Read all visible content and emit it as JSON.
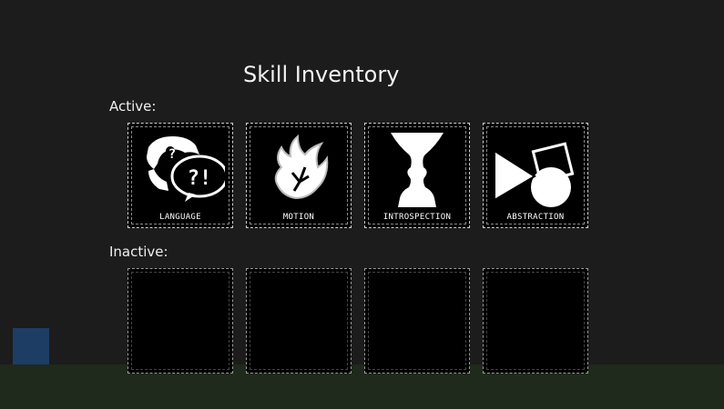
{
  "title": "Skill Inventory",
  "active": {
    "label": "Active:",
    "skills": [
      {
        "name": "LANGUAGE",
        "icon": "language-icon"
      },
      {
        "name": "MOTION",
        "icon": "motion-icon"
      },
      {
        "name": "INTROSPECTION",
        "icon": "introspection-icon"
      },
      {
        "name": "ABSTRACTION",
        "icon": "abstraction-icon"
      }
    ]
  },
  "inactive": {
    "label": "Inactive:",
    "slots": 4
  },
  "colors": {
    "background": "#1c1c1c",
    "ground": "#1f2a1c",
    "player_block": "#1e3d64",
    "slot_fill": "#000000",
    "slot_border": "#cfcfcf",
    "text": "#f2f2f2"
  }
}
